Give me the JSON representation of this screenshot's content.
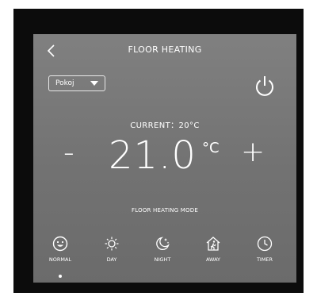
{
  "header": {
    "title": "FLOOR HEATING"
  },
  "room_select": {
    "value": "Pokoj"
  },
  "status": {
    "current_label": "CURRENT：20°C"
  },
  "thermostat": {
    "setpoint": "21.0",
    "unit": "°C",
    "decrease_label": "-",
    "increase_label": "+"
  },
  "mode_section": {
    "label": "FLOOR HEATING MODE"
  },
  "modes": [
    {
      "label": "NORMAL",
      "icon": "smiley-icon"
    },
    {
      "label": "DAY",
      "icon": "sun-icon"
    },
    {
      "label": "NIGHT",
      "icon": "moon-icon"
    },
    {
      "label": "AWAY",
      "icon": "house-away-icon"
    },
    {
      "label": "TIMER",
      "icon": "clock-icon"
    }
  ],
  "selected_mode": "NORMAL",
  "colors": {
    "screen": "#7a7a7a",
    "bezel": "#0c0c0c",
    "foreground": "#ffffff"
  }
}
